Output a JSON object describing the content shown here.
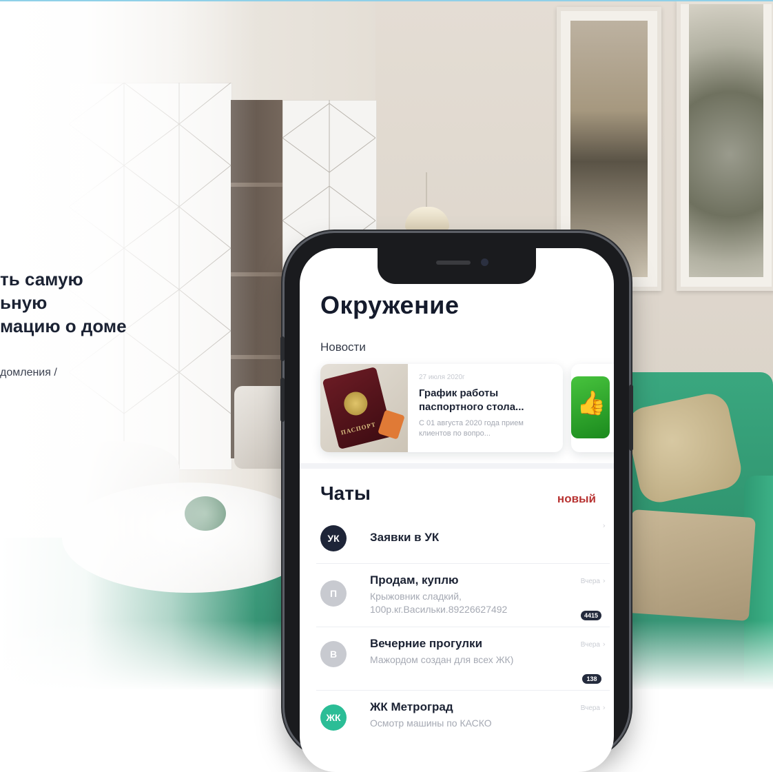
{
  "promo": {
    "headline_lines": [
      "ть самую",
      "ьную",
      "мацию о доме"
    ],
    "subline": "домления /"
  },
  "app": {
    "screen_title": "Окружение",
    "news_section_label": "Новости",
    "news": [
      {
        "date": "27 июля 2020г",
        "title": "График работы паспортного стола...",
        "text": "С 01 августа 2020 года прием клиентов по вопро...",
        "image_label": "ПАСПОРТ"
      }
    ],
    "chats_title": "Чаты",
    "new_chat_label": "новый",
    "chats": [
      {
        "avatar": "УК",
        "name": "Заявки в УК",
        "message": "",
        "time": "",
        "count": "",
        "avatar_color": "#1e2538"
      },
      {
        "avatar": "П",
        "name": "Продам, куплю",
        "message": "Крыжовник сладкий, 100р.кг.Васильки.89226627492",
        "time": "Вчера",
        "count": "4415",
        "avatar_color": "#c8cad0"
      },
      {
        "avatar": "В",
        "name": "Вечерние прогулки",
        "message": "Мажордом создан для всех ЖК)",
        "time": "Вчера",
        "count": "138",
        "avatar_color": "#c8cad0"
      },
      {
        "avatar": "ЖК",
        "name": "ЖК Метроград",
        "message": "Осмотр машины по КАСКО",
        "time": "Вчера",
        "count": "",
        "avatar_color": "#2bbd96"
      }
    ]
  },
  "colors": {
    "accent_red": "#b83332",
    "dark_text": "#151b2c",
    "sofa_green": "#3aa77f"
  }
}
